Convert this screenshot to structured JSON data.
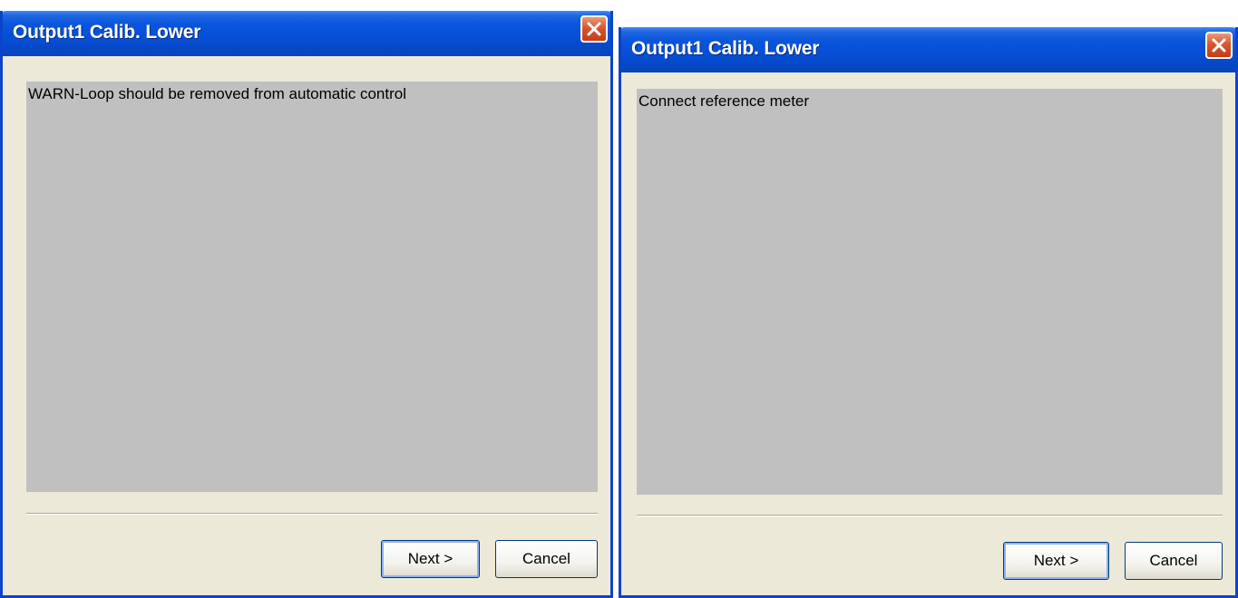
{
  "dialogs": [
    {
      "title": "Output1 Calib. Lower",
      "message": "WARN-Loop should be removed from automatic control",
      "buttons": {
        "next": "Next >",
        "cancel": "Cancel"
      }
    },
    {
      "title": "Output1 Calib. Lower",
      "message": "Connect reference meter",
      "buttons": {
        "next": "Next >",
        "cancel": "Cancel"
      }
    }
  ],
  "icons": {
    "close": "close-x-icon"
  },
  "colors": {
    "titlebar": "#0650d8",
    "close_button": "#d9572f",
    "dialog_body": "#ece9d8",
    "message_panel": "#c0c0c0"
  }
}
